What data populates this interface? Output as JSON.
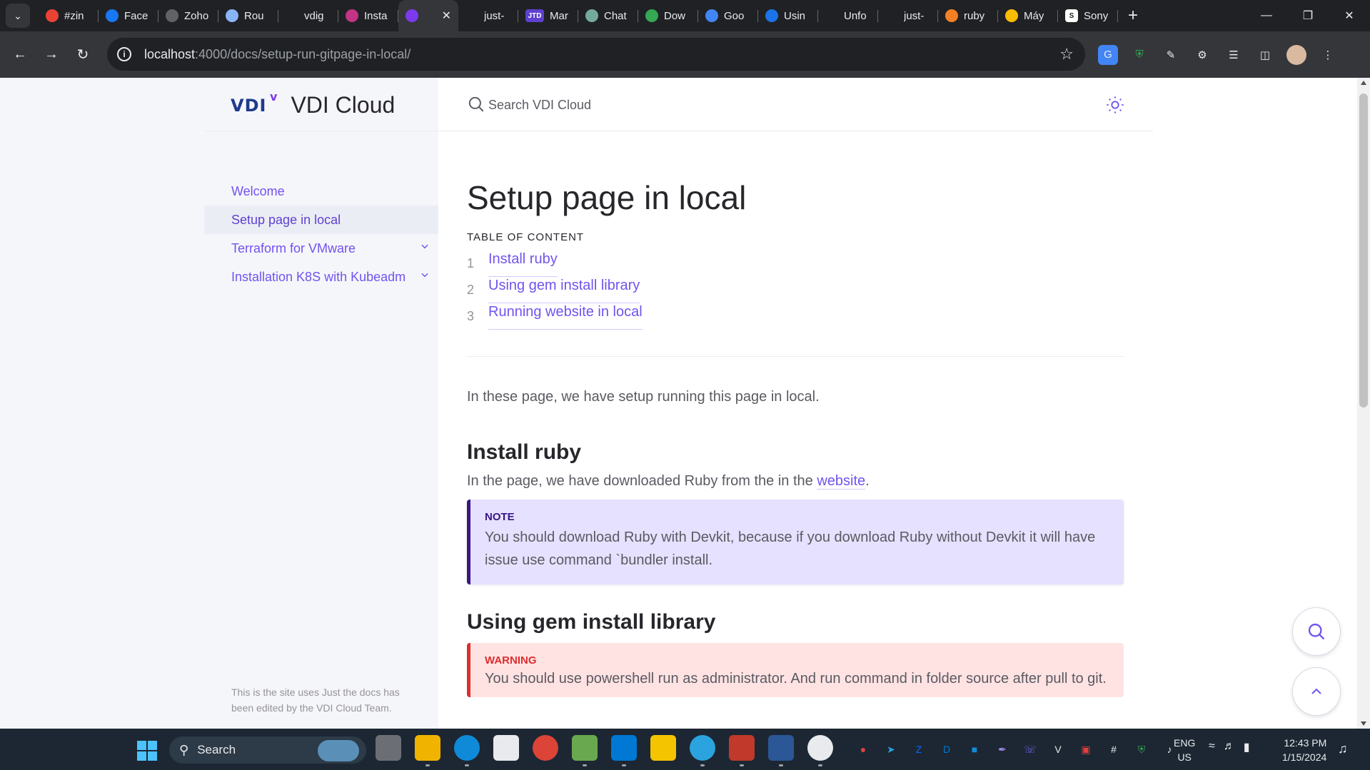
{
  "browser": {
    "tabs": [
      {
        "title": "#zin",
        "icon": "chrome-tab-icon",
        "color": "#ea4335"
      },
      {
        "title": "Face",
        "icon": "facebook-icon",
        "color": "#1877f2"
      },
      {
        "title": "Zoho",
        "icon": "zoho-icon",
        "color": "#5f6368"
      },
      {
        "title": "Rou",
        "icon": "router-icon",
        "color": "#8ab4f8"
      },
      {
        "title": "vdig",
        "icon": "github-icon",
        "color": "#202124"
      },
      {
        "title": "Insta",
        "icon": "instagram-icon",
        "color": "#c13584"
      },
      {
        "title": "",
        "icon": "vdi-tab-icon",
        "color": "#7c3aed",
        "active": true
      },
      {
        "title": "just-",
        "icon": "github-icon",
        "color": "#202124"
      },
      {
        "title": "Mar",
        "icon": "jtd-icon",
        "color": "#5e41d0",
        "fav_text": "JTD"
      },
      {
        "title": "Chat",
        "icon": "chatgpt-icon",
        "color": "#74aa9c"
      },
      {
        "title": "Dow",
        "icon": "google-drive-icon",
        "color": "#34a853"
      },
      {
        "title": "Goo",
        "icon": "google-translate-icon",
        "color": "#4285f4"
      },
      {
        "title": "Usin",
        "icon": "blue-dot-icon",
        "color": "#1a73e8"
      },
      {
        "title": "Unfo",
        "icon": "github-icon",
        "color": "#202124"
      },
      {
        "title": "just-",
        "icon": "github-icon",
        "color": "#202124"
      },
      {
        "title": "ruby",
        "icon": "stackoverflow-icon",
        "color": "#f48024"
      },
      {
        "title": "Máy",
        "icon": "warning-triangle-icon",
        "color": "#fbbc04"
      },
      {
        "title": "Sony",
        "icon": "s-logo-icon",
        "color": "#ffffff",
        "fav_text": "S"
      }
    ],
    "new_tab_symbol": "+",
    "url_host": "localhost",
    "url_path": ":4000/docs/setup-run-gitpage-in-local/"
  },
  "site": {
    "logo_text": "VDI",
    "title": "VDI Cloud",
    "search_placeholder": "Search VDI Cloud",
    "nav": [
      {
        "label": "Welcome",
        "active": false,
        "expandable": false
      },
      {
        "label": "Setup page in local",
        "active": true,
        "expandable": false
      },
      {
        "label": "Terraform for VMware",
        "active": false,
        "expandable": true
      },
      {
        "label": "Installation K8S with Kubeadm",
        "active": false,
        "expandable": true
      }
    ],
    "footer": "This is the site uses Just the docs has been edited by the VDI Cloud Team."
  },
  "content": {
    "title": "Setup page in local",
    "toc_heading": "Table of content",
    "toc": [
      {
        "num": "1",
        "label": "Install ruby"
      },
      {
        "num": "2",
        "label": "Using gem install library"
      },
      {
        "num": "3",
        "label": "Running website in local"
      }
    ],
    "intro": "In these page, we have setup running this page in local.",
    "section1": {
      "heading": "Install ruby",
      "text_before": "In the page, we have downloaded Ruby from the in the ",
      "link": "website",
      "text_after": "."
    },
    "note": {
      "label": "NOTE",
      "body": "You should download Ruby with Devkit, because if you download Ruby without Devkit it will have issue use command `bundler install."
    },
    "section2": {
      "heading": "Using gem install library"
    },
    "warning": {
      "label": "WARNING",
      "body": "You should use powershell run as administrator. And run command in folder source after pull to git."
    }
  },
  "taskbar": {
    "search_label": "Search",
    "lang_line1": "ENG",
    "lang_line2": "US",
    "time": "12:43 PM",
    "date": "1/15/2024"
  },
  "colors": {
    "accent": "#7253ed",
    "note_bg": "#e6e1ff",
    "warning_bg": "#ffe3e3",
    "warning_accent": "#dd2e2e"
  }
}
